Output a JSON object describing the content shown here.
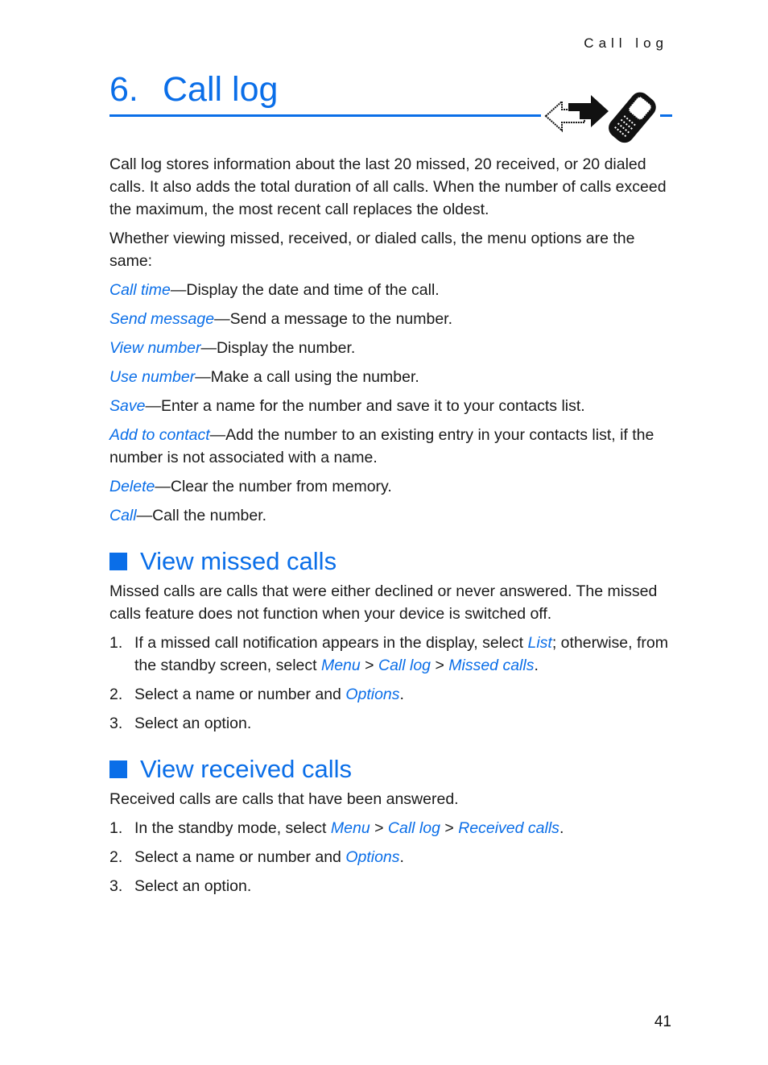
{
  "running_head": "Call log",
  "chapter": {
    "number": "6.",
    "title": "Call log",
    "icon": "phone-call-arrows-icon"
  },
  "intro": [
    "Call log stores information about the last 20 missed, 20 received, or 20 dialed calls. It also adds the total duration of all calls. When the number of calls exceed the maximum, the most recent call replaces the oldest.",
    "Whether viewing missed, received, or dialed calls, the menu options are the same:"
  ],
  "options": [
    {
      "term": "Call time",
      "desc": "—Display the date and time of the call."
    },
    {
      "term": "Send message",
      "desc": "—Send a message to the number."
    },
    {
      "term": "View number",
      "desc": "—Display the number."
    },
    {
      "term": "Use number",
      "desc": "—Make a call using the number."
    },
    {
      "term": "Save",
      "desc": "—Enter a name for the number and save it to your contacts list."
    },
    {
      "term": "Add to contact",
      "desc": "—Add the number to an existing entry in your contacts list, if the number is not associated with a name."
    },
    {
      "term": "Delete",
      "desc": "—Clear the number from memory."
    },
    {
      "term": "Call",
      "desc": "—Call the number."
    }
  ],
  "missed": {
    "heading": "View missed calls",
    "body": "Missed calls are calls that were either declined or never answered. The missed calls feature does not function when your device is switched off.",
    "steps": {
      "s1": {
        "n": "1.",
        "a": "If a missed call notification appears in the display, select ",
        "list": "List",
        "b": "; otherwise, from the standby screen, select ",
        "menu": "Menu",
        "sep1": " > ",
        "calllog": "Call log",
        "sep2": " > ",
        "target": "Missed calls",
        "end": "."
      },
      "s2": {
        "n": "2.",
        "a": "Select a name or number and ",
        "opt": "Options",
        "end": "."
      },
      "s3": {
        "n": "3.",
        "a": "Select an option."
      }
    }
  },
  "received": {
    "heading": "View received calls",
    "body": "Received calls are calls that have been answered.",
    "steps": {
      "s1": {
        "n": "1.",
        "a": "In the standby mode, select ",
        "menu": "Menu",
        "sep1": " > ",
        "calllog": "Call log",
        "sep2": " > ",
        "target": "Received calls",
        "end": "."
      },
      "s2": {
        "n": "2.",
        "a": "Select a name or number and ",
        "opt": "Options",
        "end": "."
      },
      "s3": {
        "n": "3.",
        "a": "Select an option."
      }
    }
  },
  "page_number": "41",
  "colors": {
    "accent": "#0a6ee8",
    "text": "#1a1a1a"
  }
}
